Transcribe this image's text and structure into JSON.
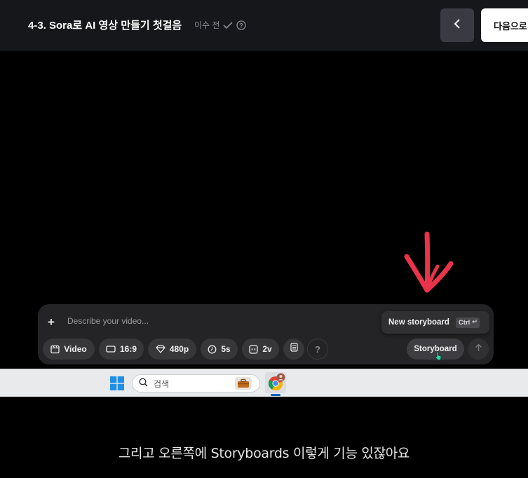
{
  "header": {
    "lesson_title": "4-3. Sora로 AI 영상 만들기 첫걸음",
    "author": "이수 전",
    "next_label": "다음으로"
  },
  "composer": {
    "placeholder": "Describe your video...",
    "chips": {
      "type": "Video",
      "aspect": "16:9",
      "resolution": "480p",
      "duration": "5s",
      "variations": "2v"
    },
    "help_label": "?",
    "storyboard_label": "Storyboard"
  },
  "tooltip": {
    "label": "New storyboard",
    "shortcut": "Ctrl"
  },
  "taskbar": {
    "search_label": "검색"
  },
  "subtitle": "그리고 오른쪽에 Storyboards 이렇게 기능 있잖아요",
  "colors": {
    "header_bg": "#16171b",
    "composer_bg": "#242426",
    "annotation": "#e8334a",
    "taskbar_bg": "#e9eaec"
  }
}
